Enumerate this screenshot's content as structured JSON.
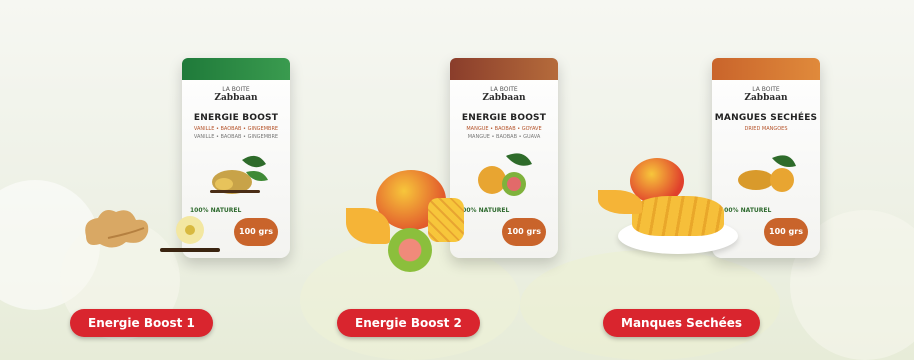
{
  "products": [
    {
      "button_label": "Energie Boost 1",
      "pouch": {
        "brand_small": "LA BOITE",
        "brand": "Zabbaan",
        "title": "ENERGIE BOOST",
        "subtitle": "VANILLE • BAOBAB • GINGEMBRE",
        "subtitle2": "VANILLE • BAOBAB • GINGEMBRE",
        "natural": "100% NATUREL",
        "weight": "100 grs",
        "accent": "#1f7a3a"
      }
    },
    {
      "button_label": "Energie Boost 2",
      "pouch": {
        "brand_small": "LA BOITE",
        "brand": "Zabbaan",
        "title": "ENERGIE BOOST",
        "subtitle": "MANGUE • BAOBAB • GOYAVE",
        "subtitle2": "MANGUE • BAOBAB • GUAVA",
        "natural": "100% NATUREL",
        "weight": "100 grs",
        "accent": "#8a3d2b"
      }
    },
    {
      "button_label": "Manques Sechées",
      "pouch": {
        "brand_small": "LA BOITE",
        "brand": "Zabbaan",
        "title": "MANGUES SECHÉES",
        "subtitle": "DRIED MANGOES",
        "subtitle2": "",
        "natural": "100% NATUREL",
        "weight": "100 grs",
        "accent": "#c9642b"
      }
    }
  ],
  "colors": {
    "button": "#d9252e",
    "leaf": "#2e6b2a"
  }
}
